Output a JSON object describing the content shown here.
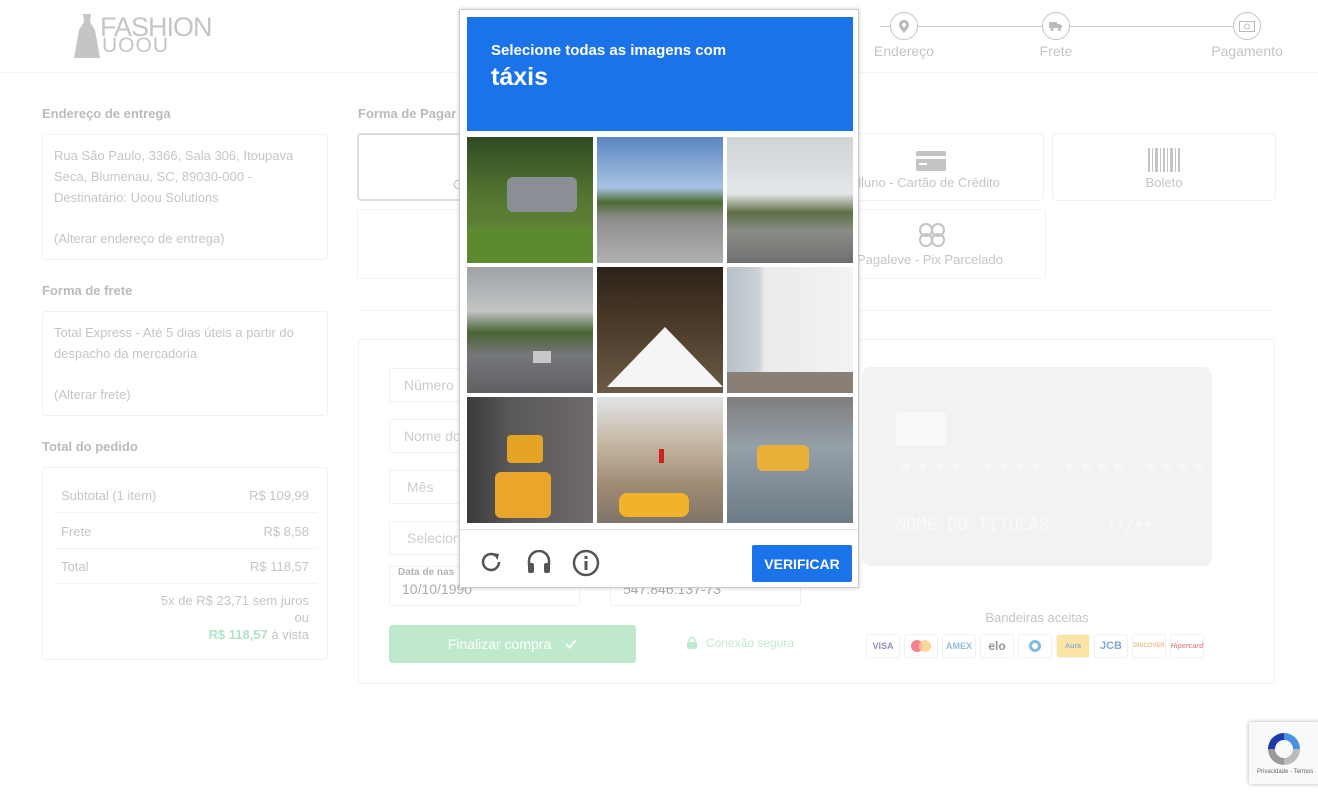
{
  "logo": {
    "line1": "FASHION",
    "line2": "UOOU"
  },
  "steps": [
    {
      "label": "Endereço",
      "icon": "map-pin-icon"
    },
    {
      "label": "Frete",
      "icon": "truck-icon"
    },
    {
      "label": "Pagamento",
      "icon": "money-icon"
    }
  ],
  "address": {
    "title": "Endereço de entrega",
    "text": "Rua São Paulo, 3366, Sala 306, Itoupava Seca, Blumenau, SC, 89030-000 - Destinatário: Uoou Solutions",
    "change": "(Alterar endereço de entrega)"
  },
  "shipping": {
    "title": "Forma de frete",
    "text": "Total Express - Até 5 dias úteis a partir do despacho da mercadoria",
    "change": "(Alterar frete)"
  },
  "order": {
    "title": "Total do pedido",
    "subtotal_label": "Subtotal (1 item)",
    "subtotal_value": "R$ 109,99",
    "frete_label": "Frete",
    "frete_value": "R$ 8,58",
    "total_label": "Total",
    "total_value": "R$ 118,57",
    "installments": "5x de R$ 23,71 sem juros",
    "ou": "ou",
    "cash_value": "R$ 118,57",
    "cash_suffix": "à vista"
  },
  "payment": {
    "title": "Forma de Pagar",
    "options": [
      {
        "label": "C",
        "icon": "calendar-icon"
      },
      {
        "label": "elluno - Cartão de Crédito",
        "icon": "credit-card-icon"
      },
      {
        "label": "Boleto",
        "icon": "barcode-icon"
      },
      {
        "label": "Pagaleve - Pix Parcelado",
        "icon": "pix-icon"
      }
    ]
  },
  "form": {
    "number_placeholder": "Número",
    "name_placeholder": "Nome do",
    "month_placeholder": "Mês",
    "select_placeholder": "Selecior",
    "birth_label": "Data de nas",
    "birth_value": "10/10/1990",
    "cpf_value": "547.846.137-73",
    "submit": "Finalizar compra",
    "secure": "Conexão segura"
  },
  "card_preview": {
    "number": "**** **** **** ****",
    "holder": "NOME DO TITULAR",
    "expiry": "**/**"
  },
  "brands": {
    "title": "Bandeiras aceitas",
    "items": [
      "VISA",
      "mastercard",
      "AMEX",
      "elo",
      "diners",
      "Aura",
      "JCB",
      "DISCOVER",
      "Hipercard"
    ]
  },
  "captcha": {
    "instruction": "Selecione todas as imagens com",
    "target": "táxis",
    "verify": "VERIFICAR"
  },
  "recaptcha_badge": {
    "text": "Privacidade - Termos"
  },
  "colors": {
    "captcha_blue": "#1a73e8",
    "submit_green": "#7ed39a",
    "accent_green": "#5fc98a"
  }
}
